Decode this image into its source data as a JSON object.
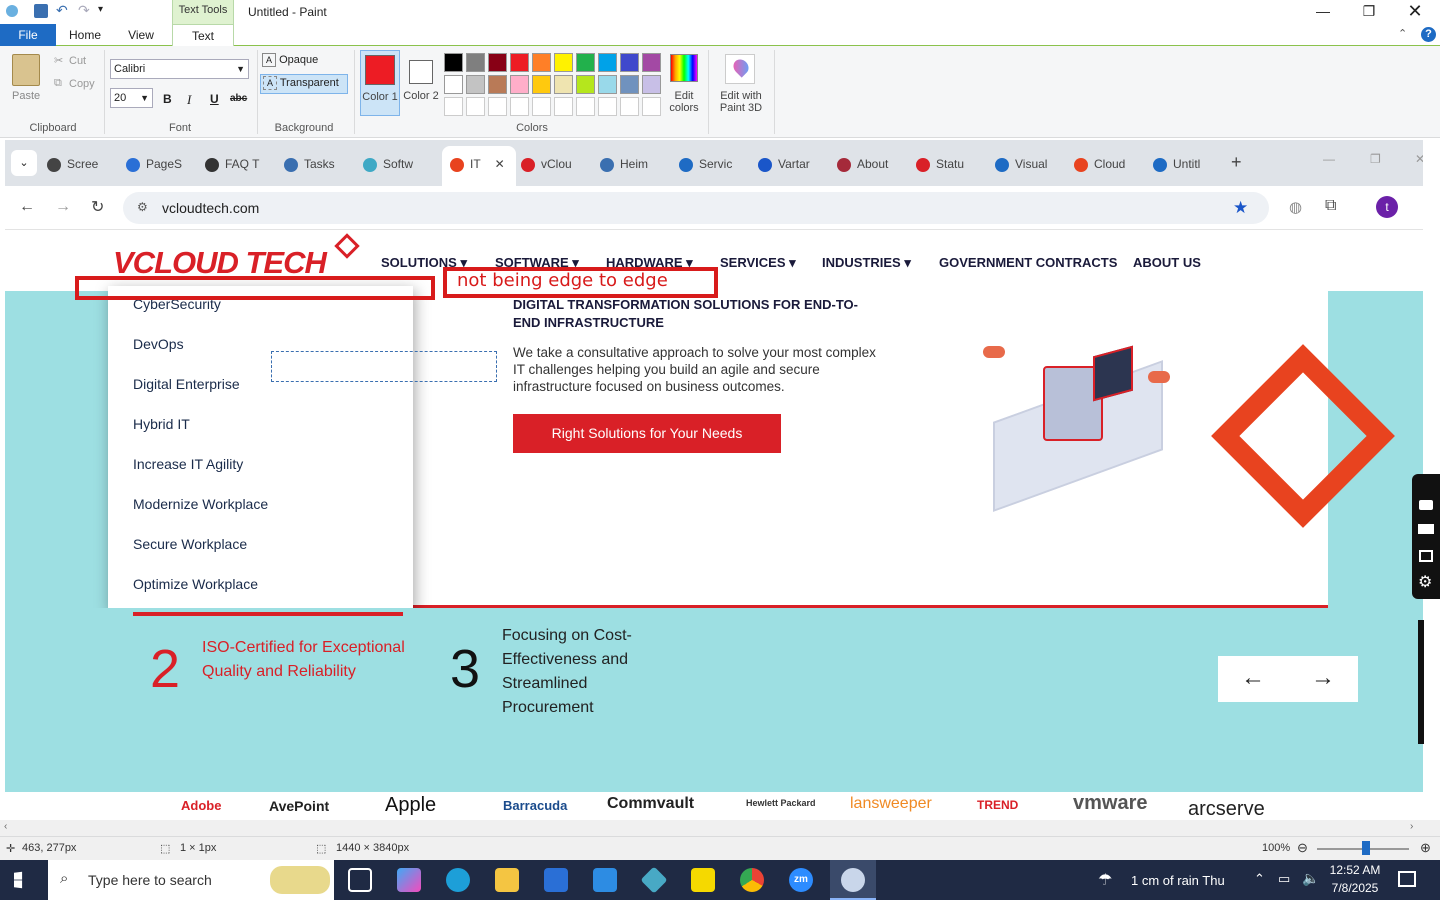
{
  "paint": {
    "title": "Untitled - Paint",
    "context_tab": "Text Tools",
    "menu_tabs": [
      "File",
      "Home",
      "View",
      "Text"
    ],
    "clipboard": {
      "paste": "Paste",
      "cut": "Cut",
      "copy": "Copy",
      "label": "Clipboard"
    },
    "font": {
      "family": "Calibri",
      "size": "20",
      "bold": "B",
      "italic": "I",
      "underline": "U",
      "strike": "abc",
      "label": "Font"
    },
    "background": {
      "opaque": "Opaque",
      "transparent": "Transparent",
      "label": "Background"
    },
    "colors": {
      "color1": "Color 1",
      "color2": "Color 2",
      "edit": "Edit colors",
      "paint3d": "Edit with Paint 3D",
      "label": "Colors",
      "color1_value": "#ed1c24",
      "color2_value": "#ffffff",
      "palette_row1": [
        "#000000",
        "#7f7f7f",
        "#880015",
        "#ed1c24",
        "#ff7f27",
        "#fff200",
        "#22b14c",
        "#00a2e8",
        "#3f48cc",
        "#a349a4"
      ],
      "palette_row2": [
        "#ffffff",
        "#c3c3c3",
        "#b97a57",
        "#ffaec9",
        "#ffc90e",
        "#efe4b0",
        "#b5e61d",
        "#99d9ea",
        "#7092be",
        "#c8bfe7"
      ]
    },
    "status": {
      "cursor": "463, 277px",
      "selection": "1 × 1px",
      "size": "1440 × 3840px",
      "zoom": "100%"
    }
  },
  "browser": {
    "tabs": [
      "Scree",
      "PageS",
      "FAQ T",
      "Tasks",
      "Softw",
      "IT",
      "vClou",
      "Heim",
      "Servic",
      "Vartar",
      "About",
      "Statu",
      "Visual",
      "Cloud",
      "Untitl"
    ],
    "url": "vcloudtech.com"
  },
  "site": {
    "logo": "VCLOUD TECH",
    "nav": [
      "SOLUTIONS",
      "SOFTWARE",
      "HARDWARE",
      "SERVICES",
      "INDUSTRIES",
      "GOVERNMENT CONTRACTS",
      "ABOUT US"
    ],
    "dropdown": [
      "CyberSecurity",
      "DevOps",
      "Digital Enterprise",
      "Hybrid IT",
      "Increase IT Agility",
      "Modernize Workplace",
      "Secure Workplace",
      "Optimize Workplace"
    ],
    "hero_title": "DIGITAL TRANSFORMATION SOLUTIONS FOR END-TO-END INFRASTRUCTURE",
    "hero_body": "We take a consultative approach to solve your most complex IT challenges helping you build an agile and secure infrastructure focused on business outcomes.",
    "hero_button": "Right Solutions for Your Needs",
    "stat2_num": "2",
    "stat2_text": "ISO-Certified for Exceptional Quality and Reliability",
    "stat3_num": "3",
    "stat3_text": "Focusing on Cost-Effectiveness and Streamlined Procurement",
    "prev": "←",
    "next": "→",
    "partners": [
      "Adobe",
      "AvePoint",
      "Apple",
      "Barracuda",
      "Commvault",
      "Hewlett Packard",
      "lansweeper",
      "TREND",
      "vmware",
      "arcserve"
    ]
  },
  "annotation": {
    "text": "not being edge to edge"
  },
  "taskbar": {
    "search": "Type here to search",
    "weather": "1 cm of rain Thu",
    "time": "12:52 AM",
    "date": "7/8/2025"
  }
}
